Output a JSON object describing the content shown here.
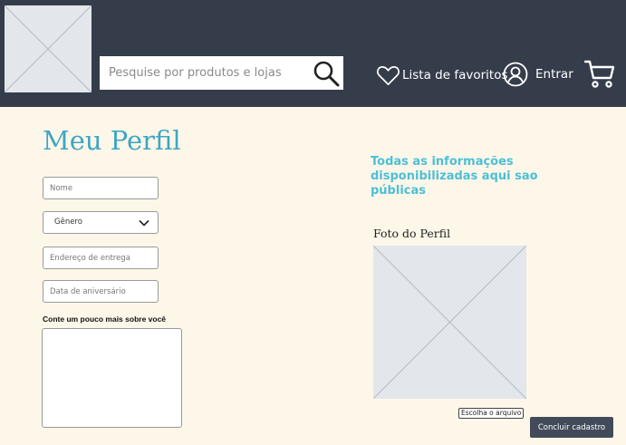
{
  "header": {
    "logo_icon": "image-placeholder-icon",
    "search": {
      "placeholder": "Pesquise por produtos e lojas",
      "value": "",
      "icon": "search-icon"
    },
    "favorites_label": "Lista de favoritos",
    "favorites_icon": "heart-icon",
    "login_label": "Entrar",
    "login_icon": "user-circle-icon",
    "cart_icon": "cart-icon",
    "background": "#353d4b"
  },
  "profile": {
    "title": "Meu Perfil",
    "name_placeholder": "Nome",
    "gender_value": "Gênero",
    "address_placeholder": "Endereço de entrega",
    "birthday_placeholder": "Data de aniversário",
    "about_label": "Conte um pouco mais sobre você",
    "about_value": ""
  },
  "info_text": "Todas as informações disponibilizadas aqui sao públicas",
  "photo": {
    "label": "Foto do Perfil",
    "choose_file_label": "Escolha o arquivo",
    "icon": "image-placeholder-icon"
  },
  "submit_label": "Concluir cadastro",
  "colors": {
    "accent": "#3fa6c3",
    "info": "#4dbfd6",
    "page_background": "#fdf7e9",
    "button": "#434b5a"
  }
}
